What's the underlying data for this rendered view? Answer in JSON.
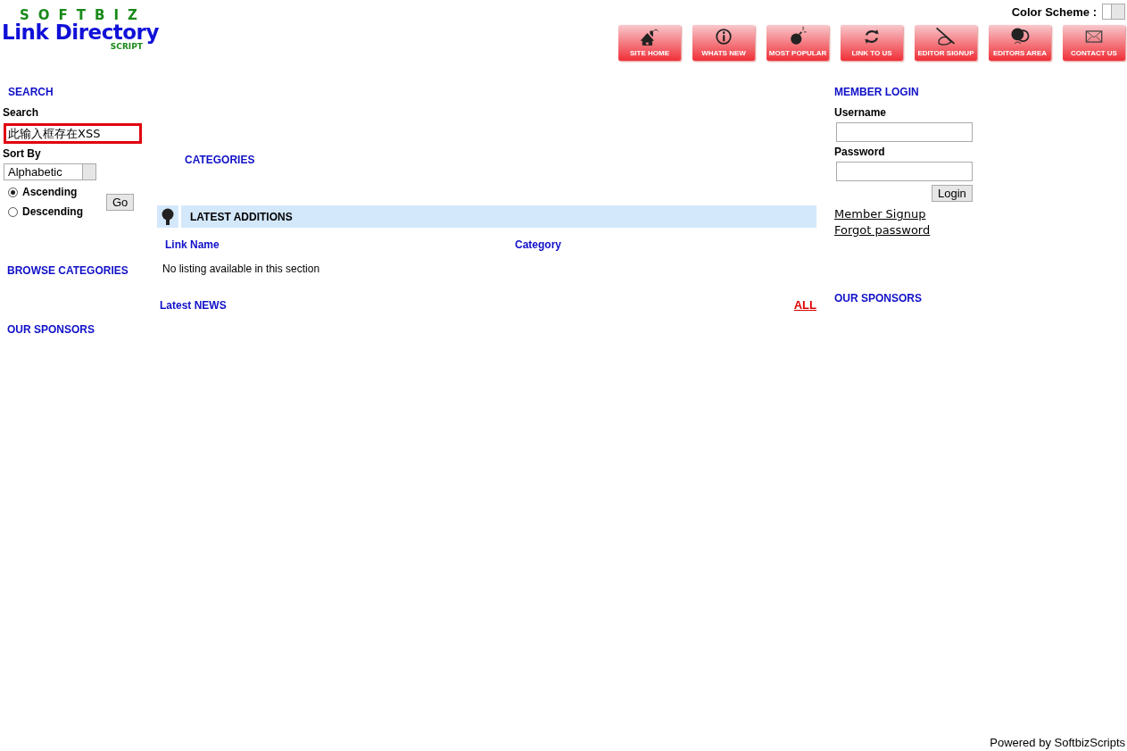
{
  "logo": {
    "top": "SOFTBIZ",
    "main": "Link Directory",
    "sub": "SCRIPT"
  },
  "color_scheme": {
    "label": "Color Scheme :"
  },
  "nav_buttons": [
    "SITE HOME",
    "WHATS NEW",
    "MOST POPULAR",
    "LINK TO US",
    "EDITOR SIGNUP",
    "EDITORS AREA",
    "CONTACT US"
  ],
  "left": {
    "search_heading": "SEARCH",
    "search_label": "Search",
    "search_value": "此输入框存在XSS",
    "sort_label": "Sort By",
    "sort_value": "Alphabetic",
    "order": [
      {
        "label": "Ascending",
        "selected": true
      },
      {
        "label": "Descending",
        "selected": false
      }
    ],
    "go": "Go",
    "browse_heading": "BROWSE CATEGORIES",
    "sponsors_heading": "OUR SPONSORS"
  },
  "center": {
    "categories_heading": "CATEGORIES",
    "additions_heading": "LATEST ADDITIONS",
    "columns": [
      "Link Name",
      "Category"
    ],
    "empty": "No listing available in this section",
    "news_heading": "Latest NEWS",
    "news_all": "ALL"
  },
  "right": {
    "login_heading": "MEMBER LOGIN",
    "username_label": "Username",
    "password_label": "Password",
    "login": "Login",
    "links": [
      "Member Signup",
      "Forgot password"
    ],
    "sponsors_heading": "OUR SPONSORS"
  },
  "footer": "Powered by SoftbizScripts"
}
